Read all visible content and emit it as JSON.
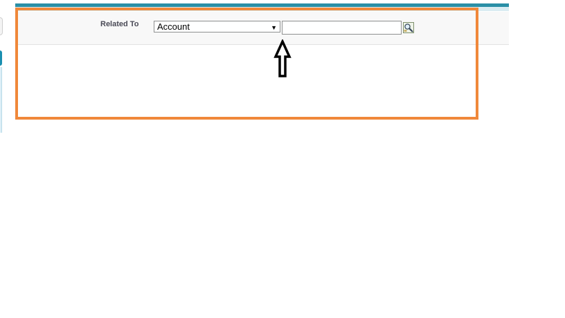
{
  "form": {
    "related_to_label": "Related To",
    "related_to_select": {
      "selected": "Account",
      "options": [
        "Account"
      ]
    },
    "lookup_input": {
      "value": "",
      "placeholder": ""
    }
  },
  "icons": {
    "lookup": "magnifier-lookup-icon",
    "select_arrow": "dropdown-arrow-icon",
    "annotation_arrow": "up-arrow-annotation-icon"
  },
  "colors": {
    "highlight": "#f0883a",
    "top_strip": "#2a8fa6",
    "sidebar_accent": "#1a8fb0"
  }
}
